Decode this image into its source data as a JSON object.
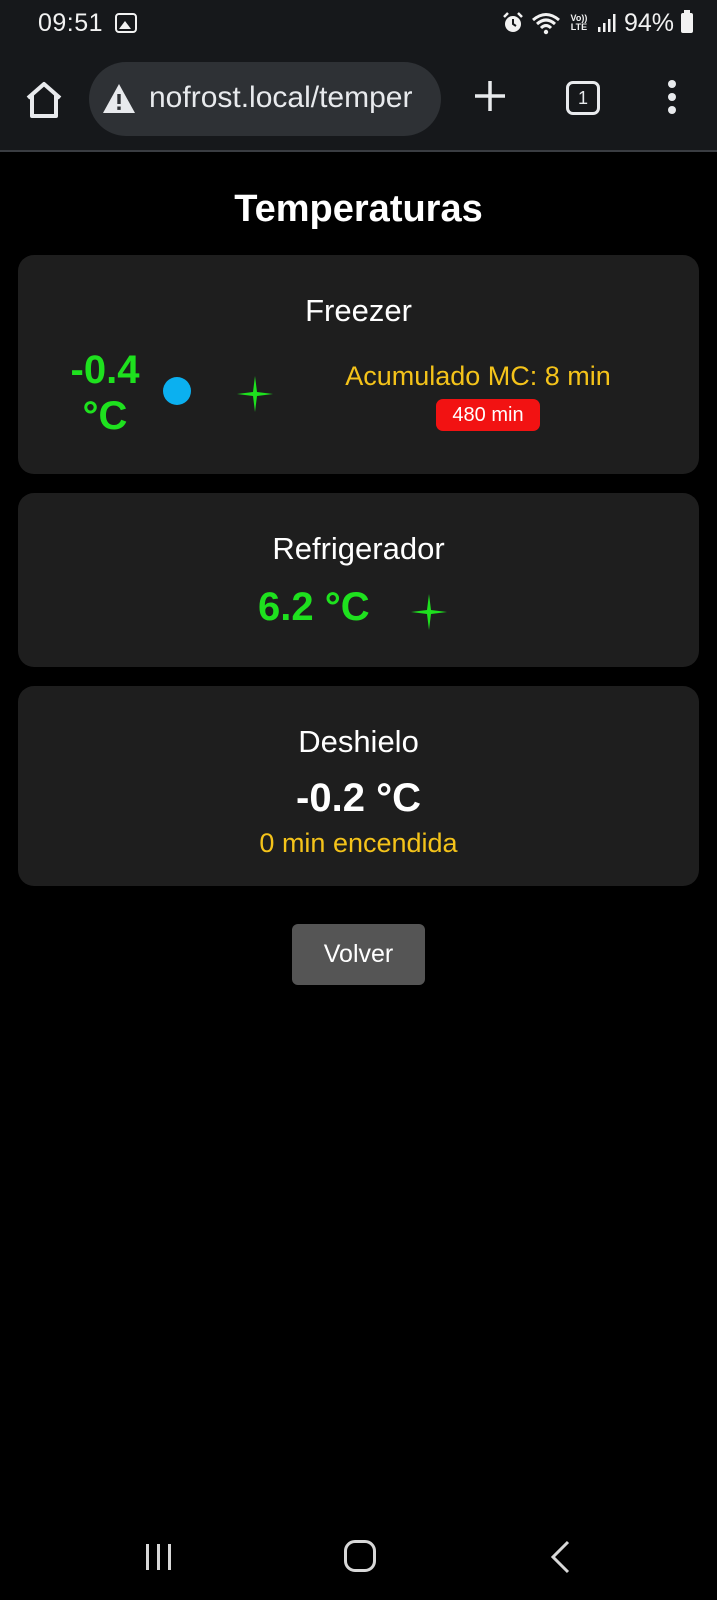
{
  "status_bar": {
    "time": "09:51",
    "battery": "94%",
    "network_label": "Vo)) LTE",
    "icons": [
      "image-icon",
      "alarm-icon",
      "wifi-icon",
      "volte-icon",
      "signal-icon",
      "battery-icon"
    ]
  },
  "browser": {
    "url": "nofrost.local/temper",
    "tab_count": "1",
    "icons": [
      "home-icon",
      "warning-icon",
      "plus-icon",
      "tabs-icon",
      "more-vert-icon"
    ]
  },
  "page": {
    "title": "Temperaturas",
    "freezer": {
      "label": "Freezer",
      "temp_value": "-0.4",
      "temp_unit": "°C",
      "accumulated": "Acumulado MC: 8 min",
      "badge": "480 min",
      "indicator_color": "#0bb0f0",
      "sparkle_color": "#1ee11e"
    },
    "refrigerador": {
      "label": "Refrigerador",
      "temp": "6.2 °C",
      "sparkle_color": "#1ee11e"
    },
    "deshielo": {
      "label": "Deshielo",
      "temp": "-0.2 °C",
      "status": "0 min encendida"
    },
    "back_button": "Volver"
  },
  "colors": {
    "temp_ok": "#1ee11e",
    "warning_text": "#f4c31a",
    "badge_bg": "#f21212",
    "card_bg": "#1e1e1e"
  }
}
